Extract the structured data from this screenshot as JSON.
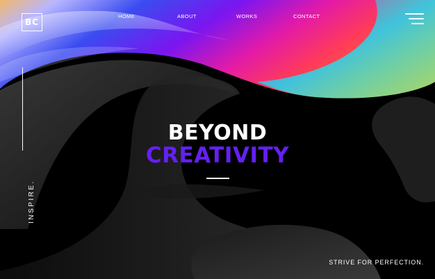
{
  "logo": {
    "text": "BC"
  },
  "nav": {
    "items": [
      {
        "label": "HOME"
      },
      {
        "label": "ABOUT"
      },
      {
        "label": "WORKS"
      },
      {
        "label": "CONTACT"
      }
    ]
  },
  "menu_icon": "hamburger-menu-icon",
  "side": {
    "text": "INSPIRE."
  },
  "hero": {
    "title_line1": "BEYOND",
    "title_line2": "CREATIVITY",
    "accent_color": "#6420f2"
  },
  "footer": {
    "tagline": "STRIVE FOR PERFECTION."
  },
  "colors": {
    "background": "#000000",
    "text": "#ffffff"
  }
}
